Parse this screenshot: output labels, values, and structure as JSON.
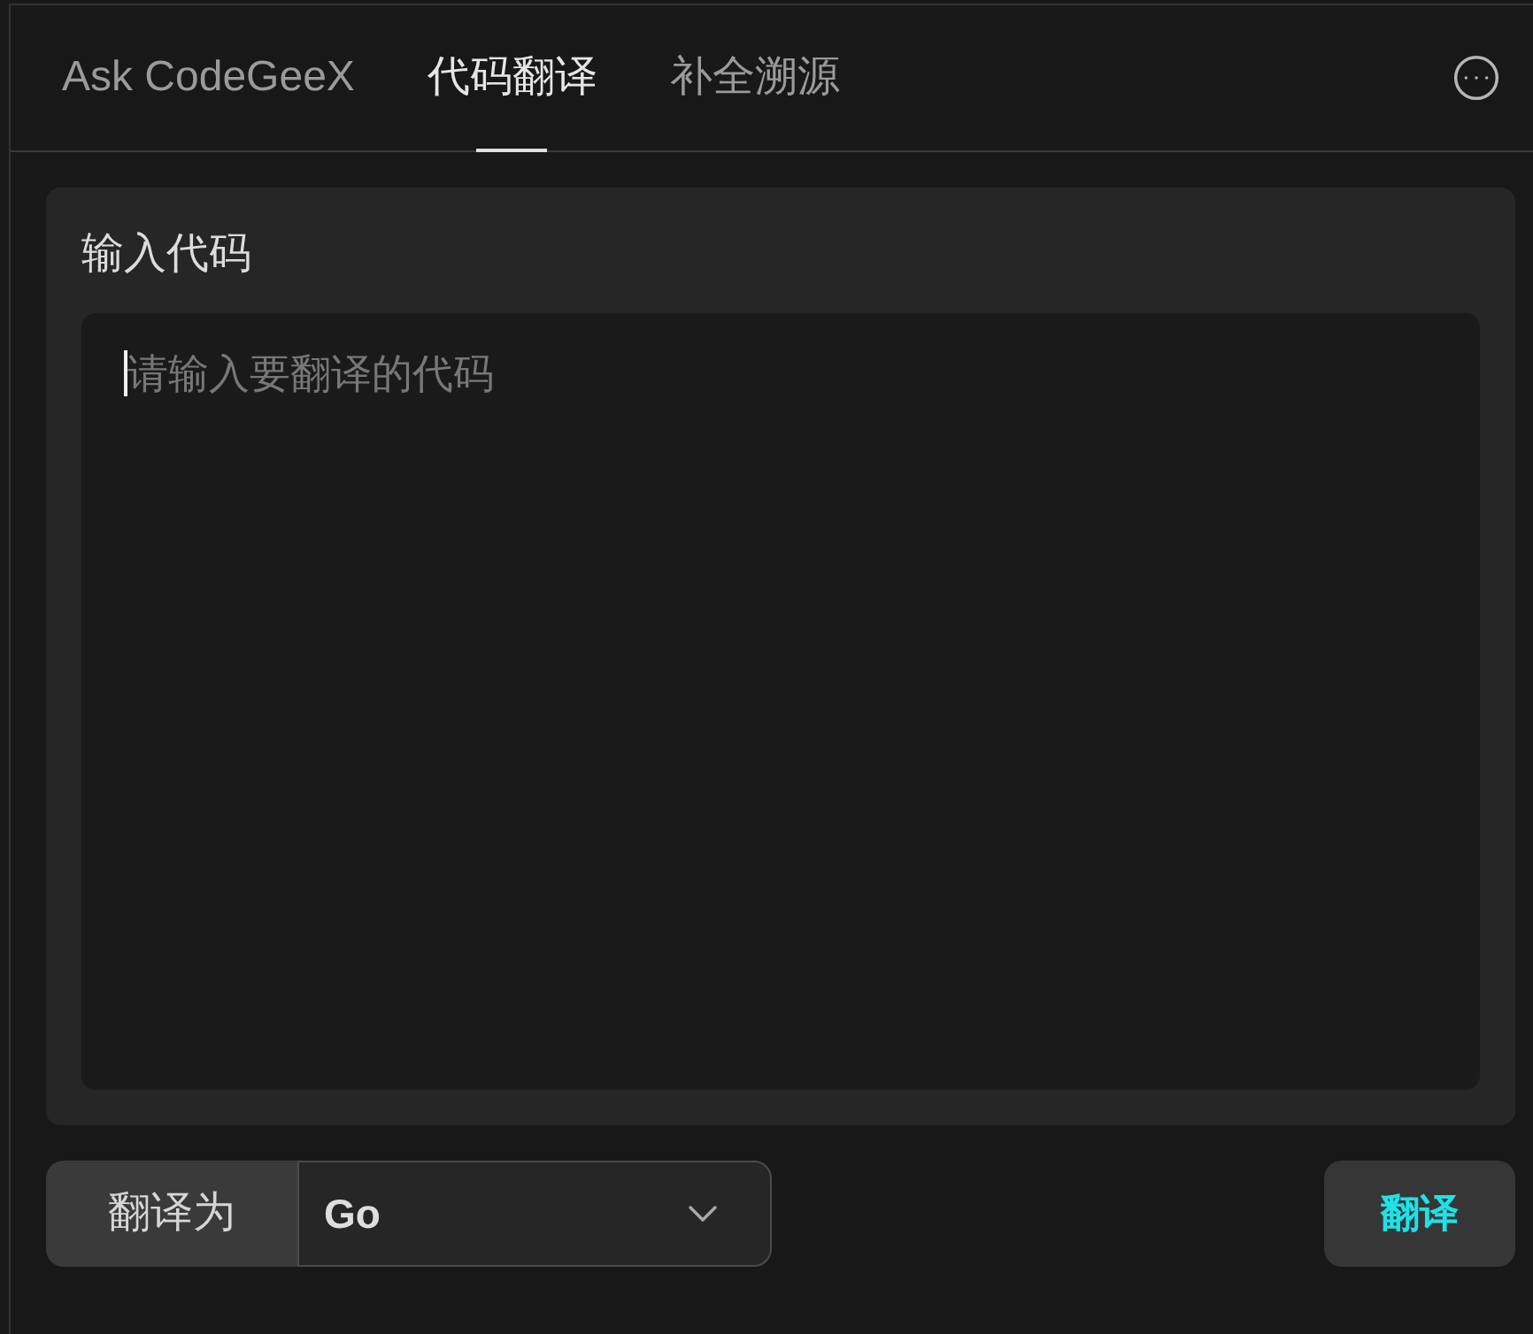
{
  "tabs": [
    {
      "label": "Ask CodeGeeX",
      "selected": false
    },
    {
      "label": "代码翻译",
      "selected": true
    },
    {
      "label": "补全溯源",
      "selected": false
    }
  ],
  "input_panel": {
    "title": "输入代码",
    "code_field": {
      "placeholder": "请输入要翻译的代码",
      "focused": true
    }
  },
  "target_language": {
    "label": "翻译为",
    "value": "Go"
  },
  "translate_button": {
    "label": "翻译"
  }
}
